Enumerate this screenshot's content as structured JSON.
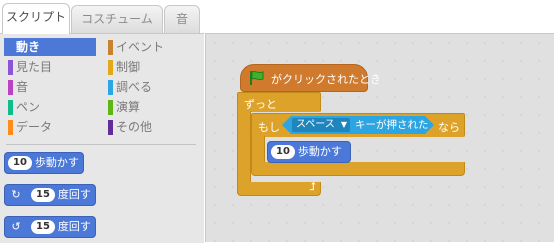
{
  "tabs": [
    {
      "label": "スクリプト",
      "active": true
    },
    {
      "label": "コスチューム",
      "active": false
    },
    {
      "label": "音",
      "active": false
    }
  ],
  "categories_left": [
    {
      "label": "動き",
      "color": "#4c78d8",
      "selected": true
    },
    {
      "label": "見た目",
      "color": "#8a55d7",
      "selected": false
    },
    {
      "label": "音",
      "color": "#bb42c3",
      "selected": false
    },
    {
      "label": "ペン",
      "color": "#0fbd8c",
      "selected": false
    },
    {
      "label": "データ",
      "color": "#ff8c1a",
      "selected": false
    }
  ],
  "categories_right": [
    {
      "label": "イベント",
      "color": "#c88330",
      "selected": false
    },
    {
      "label": "制御",
      "color": "#e1a91a",
      "selected": false
    },
    {
      "label": "調べる",
      "color": "#2ca5e2",
      "selected": false
    },
    {
      "label": "演算",
      "color": "#5cb712",
      "selected": false
    },
    {
      "label": "その他",
      "color": "#632d99",
      "selected": false
    }
  ],
  "palette_blocks": [
    {
      "value": "10",
      "label": "歩動かす",
      "icon": ""
    },
    {
      "value": "15",
      "label": "度回す",
      "icon": "rotate-right-icon"
    },
    {
      "value": "15",
      "label": "度回す",
      "icon": "rotate-left-icon"
    }
  ],
  "script": {
    "hat_label": "がクリックされたとき",
    "forever_label": "ずっと",
    "if_label": "もし",
    "key_dropdown": "スペース",
    "key_label": "キーが押された",
    "then_label": "なら",
    "move_value": "10",
    "move_label": "歩動かす"
  },
  "colors": {
    "motion": "#4c78d8",
    "control": "#dda22a",
    "events": "#cf7a2d",
    "sensing": "#2ca5e2"
  }
}
